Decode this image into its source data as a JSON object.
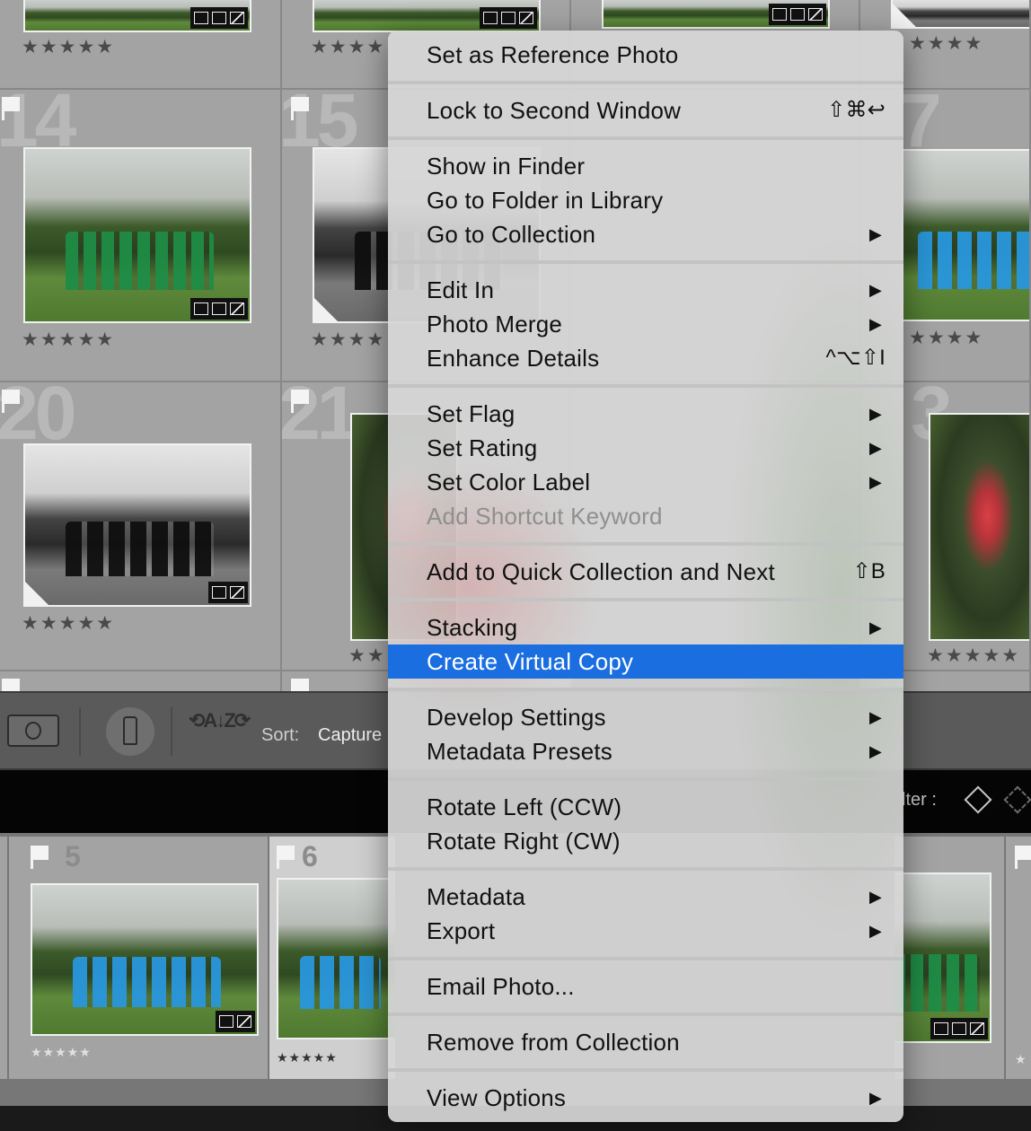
{
  "grid": {
    "row1_stars": [
      "★★★★★",
      "★★★★",
      "★★★★"
    ],
    "cells": [
      {
        "num": "14",
        "stars": "★★★★★"
      },
      {
        "num": "15",
        "stars": "★★★★"
      },
      {
        "num": "7",
        "stars": "★★★★"
      },
      {
        "num": "20",
        "stars": "★★★★★"
      },
      {
        "num": "21",
        "stars": "★★"
      },
      {
        "num": "3",
        "stars": "★★★★★"
      }
    ]
  },
  "toolbar": {
    "sort_label": "Sort:",
    "sort_value": "Capture",
    "filter_label": "lter :"
  },
  "filmstrip": {
    "cells": [
      {
        "num": "5",
        "stars": "★★★★★"
      },
      {
        "num": "6",
        "stars": "★★★★★"
      }
    ],
    "right_star": "★"
  },
  "menu": {
    "items": [
      {
        "label": "Set as Reference Photo"
      },
      {
        "label": "Lock to Second Window",
        "shortcut": "⇧⌘↩"
      },
      {
        "label": "Show in Finder"
      },
      {
        "label": "Go to Folder in Library"
      },
      {
        "label": "Go to Collection",
        "submenu": "▶"
      },
      {
        "label": "Edit In",
        "submenu": "▶"
      },
      {
        "label": "Photo Merge",
        "submenu": "▶"
      },
      {
        "label": "Enhance Details",
        "shortcut": "^⌥⇧I"
      },
      {
        "label": "Set Flag",
        "submenu": "▶"
      },
      {
        "label": "Set Rating",
        "submenu": "▶"
      },
      {
        "label": "Set Color Label",
        "submenu": "▶"
      },
      {
        "label": "Add Shortcut Keyword"
      },
      {
        "label": "Add to Quick Collection and Next",
        "shortcut": "⇧B"
      },
      {
        "label": "Stacking",
        "submenu": "▶"
      },
      {
        "label": "Create Virtual Copy"
      },
      {
        "label": "Develop Settings",
        "submenu": "▶"
      },
      {
        "label": "Metadata Presets",
        "submenu": "▶"
      },
      {
        "label": "Rotate Left (CCW)"
      },
      {
        "label": "Rotate Right (CW)"
      },
      {
        "label": "Metadata",
        "submenu": "▶"
      },
      {
        "label": "Export",
        "submenu": "▶"
      },
      {
        "label": "Email Photo..."
      },
      {
        "label": "Remove from Collection"
      },
      {
        "label": "View Options",
        "submenu": "▶"
      }
    ]
  },
  "colors": {
    "highlight": "#1a6ee0",
    "disabled_text": "#8f8f8f"
  }
}
